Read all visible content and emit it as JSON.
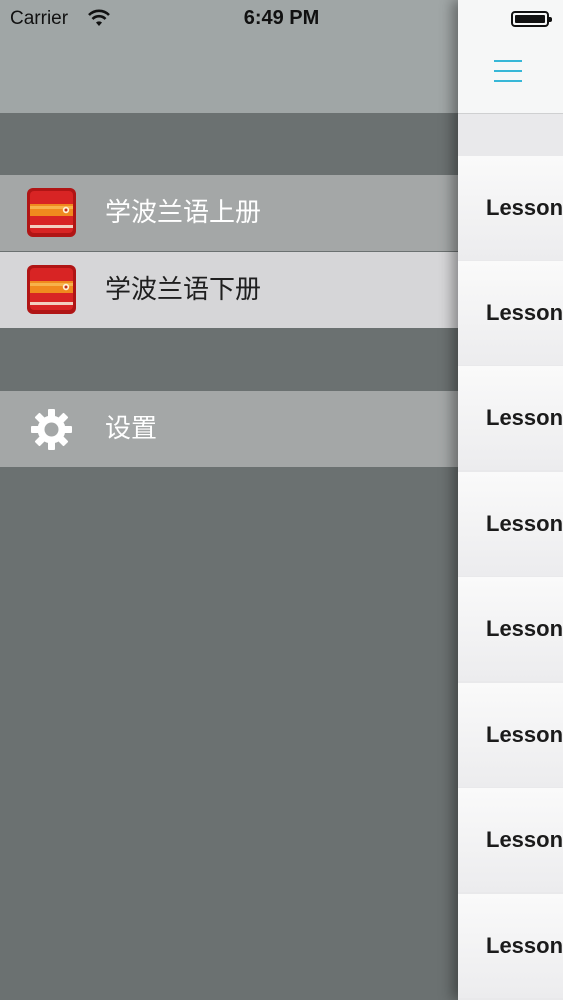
{
  "status_bar": {
    "carrier": "Carrier",
    "time": "6:49 PM"
  },
  "menu": {
    "items": [
      {
        "label": "学波兰语上册",
        "icon": "book-icon"
      },
      {
        "label": "学波兰语下册",
        "icon": "book-icon"
      }
    ],
    "settings": {
      "label": "设置",
      "icon": "gear-icon"
    }
  },
  "main": {
    "nav": {
      "menu_icon": "hamburger-icon",
      "accent_color": "#37b7d7"
    },
    "lessons": [
      "Lesson",
      "Lesson",
      "Lesson",
      "Lesson",
      "Lesson",
      "Lesson",
      "Lesson",
      "Lesson"
    ]
  }
}
